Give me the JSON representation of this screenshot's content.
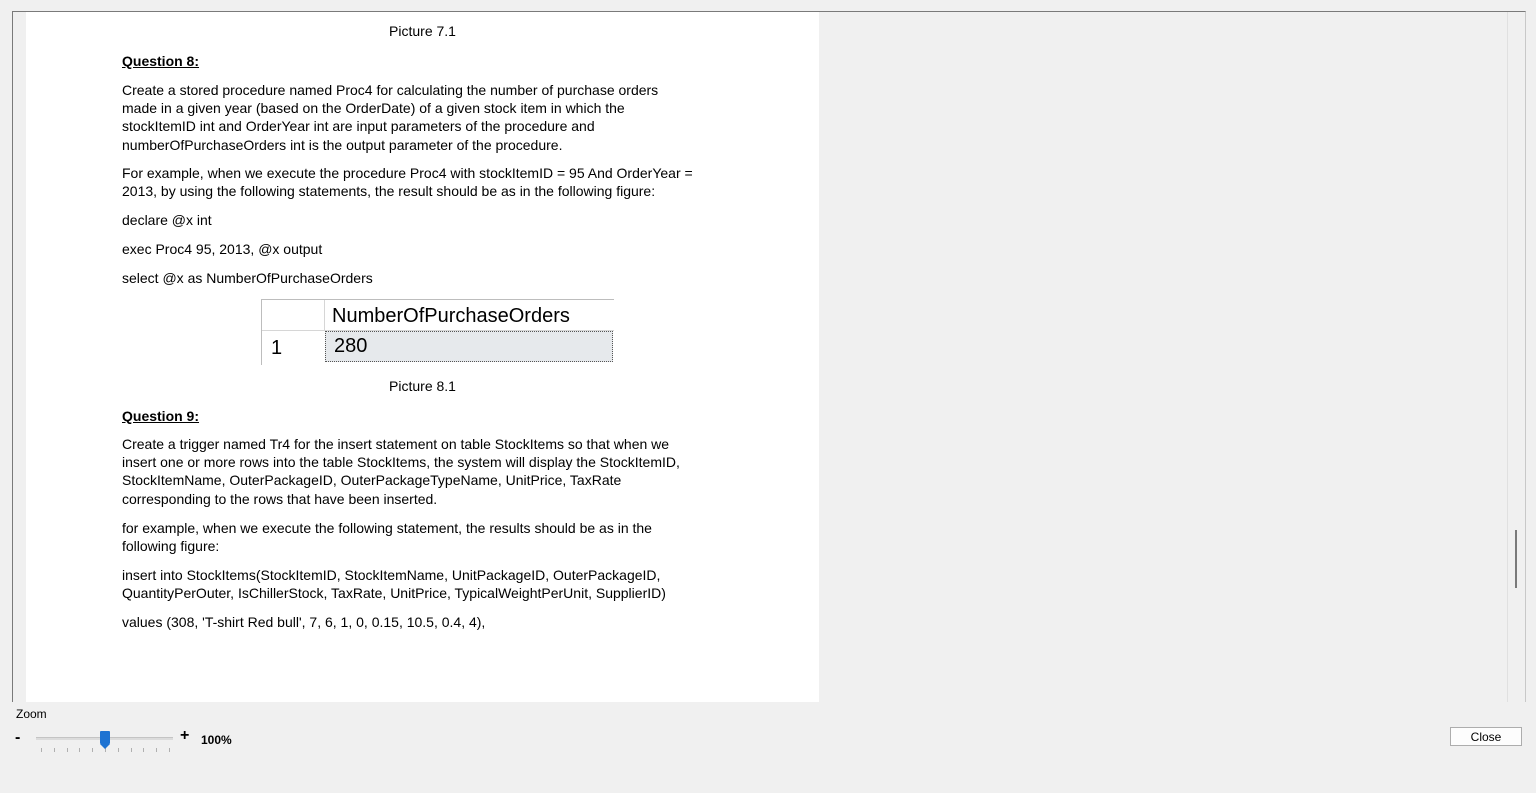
{
  "document": {
    "caption_7_1": "Picture 7.1",
    "q8_heading": "Question 8:",
    "q8_para_lines": [
      "Create a stored procedure named Proc4 for calculating the number of purchase orders",
      "made in a given year (based on the OrderDate) of a given stock item in which the",
      "stockItemID int and OrderYear int are input parameters of the procedure and",
      "numberOfPurchaseOrders int is the output parameter of the procedure."
    ],
    "q8_example_lines": [
      "For example, when we execute the procedure Proc4 with stockItemID = 95 And OrderYear =",
      "2013, by using the following statements, the result should be as in the following figure:"
    ],
    "q8_stmt1": "declare @x int",
    "q8_stmt2": "exec Proc4 95, 2013, @x output",
    "q8_stmt3": "select @x as NumberOfPurchaseOrders",
    "result_grid": {
      "column_header": "NumberOfPurchaseOrders",
      "row_number": "1",
      "value": "280"
    },
    "caption_8_1": "Picture 8.1",
    "q9_heading": "Question 9:",
    "q9_para_lines": [
      "Create a trigger named Tr4 for the insert statement on table StockItems so that when we",
      "insert one or more rows into the table StockItems, the system will display the StockItemID,",
      "StockItemName, OuterPackageID, OuterPackageTypeName, UnitPrice, TaxRate",
      "corresponding to the rows that have been inserted."
    ],
    "q9_example_lines": [
      "for example, when we execute the following statement, the results should be as in the",
      "following figure:"
    ],
    "q9_insert_lines": [
      "insert into StockItems(StockItemID, StockItemName, UnitPackageID, OuterPackageID,",
      "QuantityPerOuter, IsChillerStock, TaxRate, UnitPrice, TypicalWeightPerUnit, SupplierID)"
    ],
    "q9_values": "values (308, 'T-shirt Red bull', 7, 6, 1, 0, 0.15, 10.5, 0.4, 4),"
  },
  "zoom": {
    "label": "Zoom",
    "minus": "-",
    "plus": "+",
    "value_text": "100%",
    "level_fraction": 0.5
  },
  "footer": {
    "close_label": "Close"
  },
  "colors": {
    "accent": "#1e73d2",
    "page_background": "#ffffff",
    "window_background": "#f0f0f0"
  }
}
